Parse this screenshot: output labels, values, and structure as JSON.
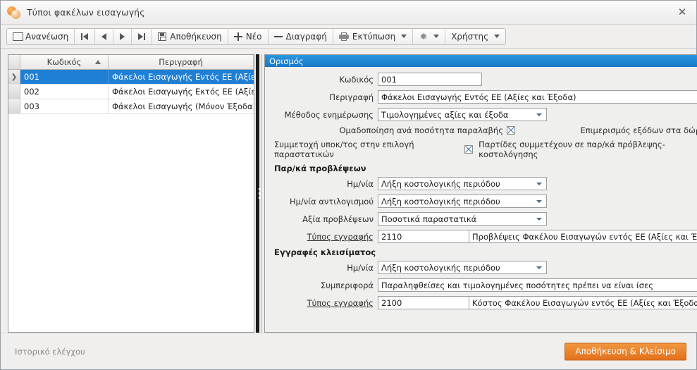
{
  "window": {
    "title": "Τύποι φακέλων εισαγωγής",
    "app_icon": "beans-icon",
    "close_label": "✕"
  },
  "toolbar": {
    "refresh": {
      "label": "Ανανέωση",
      "icon": "refresh-icon"
    },
    "nav": {
      "first": "first-record-icon",
      "prev": "previous-record-icon",
      "next": "next-record-icon",
      "last": "last-record-icon"
    },
    "save": {
      "label": "Αποθήκευση",
      "icon": "save-icon"
    },
    "new": {
      "label": "Νέο",
      "icon": "plus-icon"
    },
    "delete": {
      "label": "Διαγραφή",
      "icon": "minus-icon"
    },
    "print": {
      "label": "Εκτύπωση",
      "icon": "printer-icon"
    },
    "settings": {
      "icon": "gear-icon"
    },
    "user": {
      "label": "Χρήστης"
    }
  },
  "grid": {
    "columns": [
      {
        "key": "code",
        "label": "Κωδικός",
        "sorted": "asc"
      },
      {
        "key": "description",
        "label": "Περιγραφή",
        "sorted": ""
      }
    ],
    "rows": [
      {
        "marker": "❯",
        "code": "001",
        "description": "Φάκελοι Εισαγωγής Εντός ΕΕ (Αξίες και ...",
        "selected": true
      },
      {
        "marker": "",
        "code": "002",
        "description": "Φάκελοι Εισαγωγής Εκτός ΕΕ (Αξίες και ...",
        "selected": false
      },
      {
        "marker": "",
        "code": "003",
        "description": "Φάκελοι Εισαγωγής (Μόνον Έξοδα)",
        "selected": false
      }
    ]
  },
  "form": {
    "section_title": "Ορισμός",
    "code": {
      "label": "Κωδικός",
      "value": "001"
    },
    "description": {
      "label": "Περιγραφή",
      "value": "Φάκελοι Εισαγωγής Εντός ΕΕ (Αξίες και Έξοδα)"
    },
    "update_method": {
      "label": "Μέθοδος ενημέρωσης",
      "value": "Τιμολογημένες αξίες και έξοδα"
    },
    "checkboxes": {
      "group_by_receipt_qty": {
        "label": "Ομαδοποίηση ανά ποσότητα παραλαβής",
        "checked": true
      },
      "allocate_expenses_gifts": {
        "label": "Επιμερισμός εξόδων στα δώρα",
        "checked": false
      },
      "branch_participation": {
        "label": "Συμμετοχή υποκ/τος στην επιλογή παραστατικών",
        "checked": true
      },
      "batches_participate": {
        "label": "Παρτίδες συμμετέχουν σε παρ/κά πρόβλεψης-κοστολόγησης",
        "checked": false
      }
    },
    "forecast": {
      "group_title": "Παρ/κά προβλέψεων",
      "date": {
        "label": "Ημ/νία",
        "value": "Λήξη κοστολογικής περιόδου"
      },
      "reversal_date": {
        "label": "Ημ/νία αντιλογισμού",
        "value": "Λήξη κοστολογικής περιόδου"
      },
      "forecast_value": {
        "label": "Αξία προβλέψεων",
        "value": "Ποσοτικά παραστατικά"
      },
      "entry_type": {
        "label": "Τύπος εγγραφής",
        "code": "2110",
        "value": "Προβλέψεις Φακέλου Εισαγωγών εντός ΕΕ (Αξίες και Έξοδα)"
      }
    },
    "closing": {
      "group_title": "Εγγραφές κλεισίματος",
      "date": {
        "label": "Ημ/νία",
        "value": "Λήξη κοστολογικής περιόδου"
      },
      "behavior": {
        "label": "Συμπεριφορά",
        "value": "Παραληφθείσες και τιμολογημένες ποσότητες πρέπει να είναι ίσες"
      },
      "entry_type": {
        "label": "Τύπος εγγραφής",
        "code": "2100",
        "value": "Κόστος Φακέλου Εισαγωγών εντός ΕΕ (Αξίες και Έξοδα)"
      }
    }
  },
  "footer": {
    "audit_label": "Ιστορικό ελέγχου",
    "save_close_label": "Αποθήκευση & Κλείσιμο"
  },
  "colors": {
    "accent_blue": "#1f7fd4",
    "section_blue": "#1478c8",
    "save_orange": "#e4701c"
  }
}
